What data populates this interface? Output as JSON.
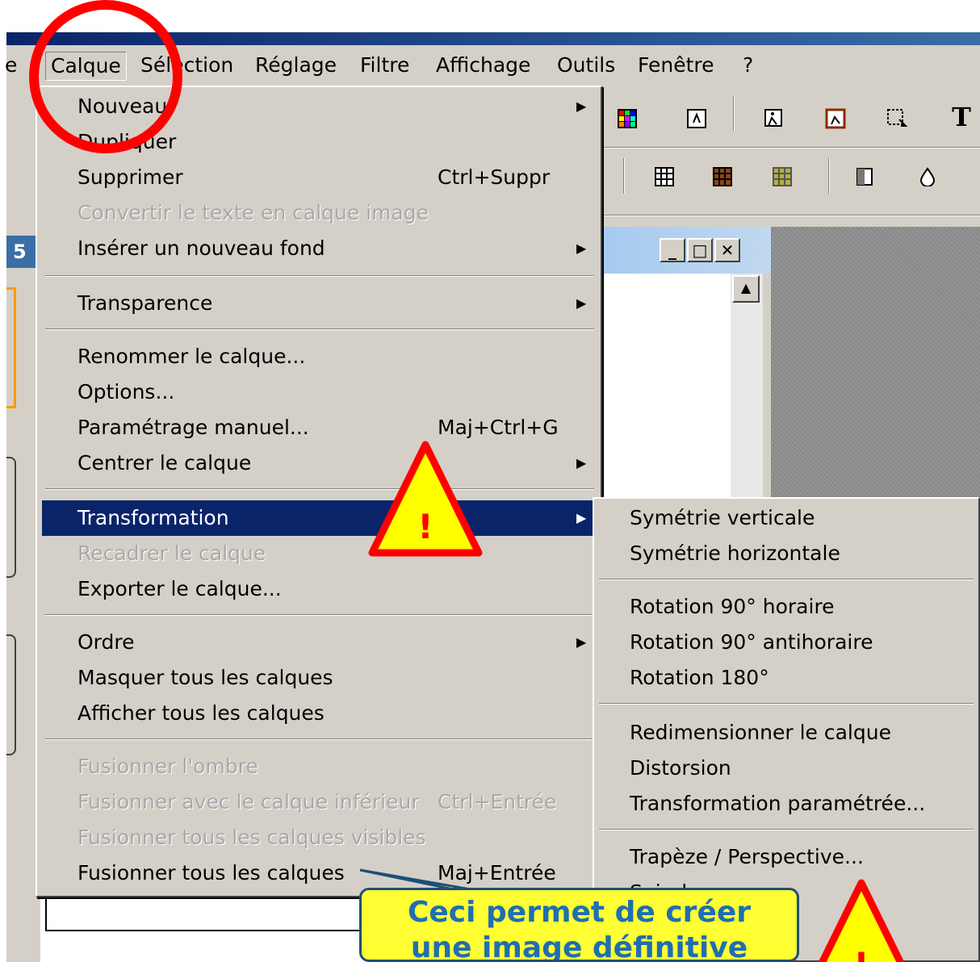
{
  "menubar": {
    "items": [
      "e",
      "Calque",
      "Sélection",
      "Réglage",
      "Filtre",
      "Affichage",
      "Outils",
      "Fenêtre",
      "?"
    ]
  },
  "left_panel": {
    "badge": "5"
  },
  "dropdown": {
    "items": [
      {
        "label": "Nouveau",
        "shortcut": "",
        "submenu": true,
        "disabled": false
      },
      {
        "label": "Dupliquer",
        "shortcut": "",
        "submenu": false,
        "disabled": false
      },
      {
        "label": "Supprimer",
        "shortcut": "Ctrl+Suppr",
        "submenu": false,
        "disabled": false
      },
      {
        "label": "Convertir le texte en calque image",
        "shortcut": "",
        "submenu": false,
        "disabled": true
      },
      {
        "label": "Insérer un nouveau fond",
        "shortcut": "",
        "submenu": true,
        "disabled": false
      },
      {
        "label": "Transparence",
        "shortcut": "",
        "submenu": true,
        "disabled": false
      },
      {
        "label": "Renommer le calque...",
        "shortcut": "",
        "submenu": false,
        "disabled": false
      },
      {
        "label": "Options...",
        "shortcut": "",
        "submenu": false,
        "disabled": false
      },
      {
        "label": "Paramétrage manuel...",
        "shortcut": "Maj+Ctrl+G",
        "submenu": false,
        "disabled": false
      },
      {
        "label": "Centrer le calque",
        "shortcut": "",
        "submenu": true,
        "disabled": false
      },
      {
        "label": "Transformation",
        "shortcut": "",
        "submenu": true,
        "disabled": false,
        "highlighted": true
      },
      {
        "label": "Recadrer le calque",
        "shortcut": "",
        "submenu": false,
        "disabled": true
      },
      {
        "label": "Exporter le calque...",
        "shortcut": "",
        "submenu": false,
        "disabled": false
      },
      {
        "label": "Ordre",
        "shortcut": "",
        "submenu": true,
        "disabled": false
      },
      {
        "label": "Masquer tous les calques",
        "shortcut": "",
        "submenu": false,
        "disabled": false
      },
      {
        "label": "Afficher tous les calques",
        "shortcut": "",
        "submenu": false,
        "disabled": false
      },
      {
        "label": "Fusionner l'ombre",
        "shortcut": "",
        "submenu": false,
        "disabled": true
      },
      {
        "label": "Fusionner avec le calque inférieur",
        "shortcut": "Ctrl+Entrée",
        "submenu": false,
        "disabled": true
      },
      {
        "label": "Fusionner tous les calques visibles",
        "shortcut": "",
        "submenu": false,
        "disabled": true
      },
      {
        "label": "Fusionner tous les calques",
        "shortcut": "Maj+Entrée",
        "submenu": false,
        "disabled": false
      }
    ]
  },
  "submenu": {
    "items": [
      "Symétrie verticale",
      "Symétrie horizontale",
      "Rotation 90° horaire",
      "Rotation 90° antihoraire",
      "Rotation 180°",
      "Redimensionner le calque",
      "Distorsion",
      "Transformation paramétrée...",
      "Trapèze / Perspective...",
      "Spirale"
    ]
  },
  "annotations": {
    "warning_mark": "!",
    "callout_line1": "Ceci permet de créer",
    "callout_line2": "une image définitive",
    "circle_color": "#ff0000",
    "callout_bg": "#ffff33"
  },
  "icons": [
    "palette-icon",
    "layer-icon",
    "walk-icon",
    "frame-walk-icon",
    "selection-icon",
    "text-tool-icon",
    "grid-icon",
    "grid-brown-icon",
    "grid-olive-icon",
    "contrast-icon",
    "drop-icon"
  ]
}
